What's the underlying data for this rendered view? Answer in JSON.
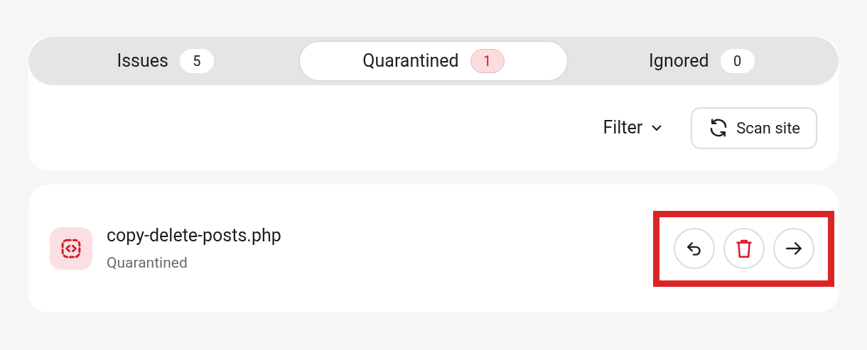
{
  "tabs": [
    {
      "label": "Issues",
      "count": "5",
      "selected": false,
      "alert": false
    },
    {
      "label": "Quarantined",
      "count": "1",
      "selected": true,
      "alert": true
    },
    {
      "label": "Ignored",
      "count": "0",
      "selected": false,
      "alert": false
    }
  ],
  "toolbar": {
    "filter": "Filter",
    "scan_button": "Scan site"
  },
  "items": [
    {
      "name": "copy-delete-posts.php",
      "status": "Quarantined",
      "actions_highlighted": true
    }
  ]
}
